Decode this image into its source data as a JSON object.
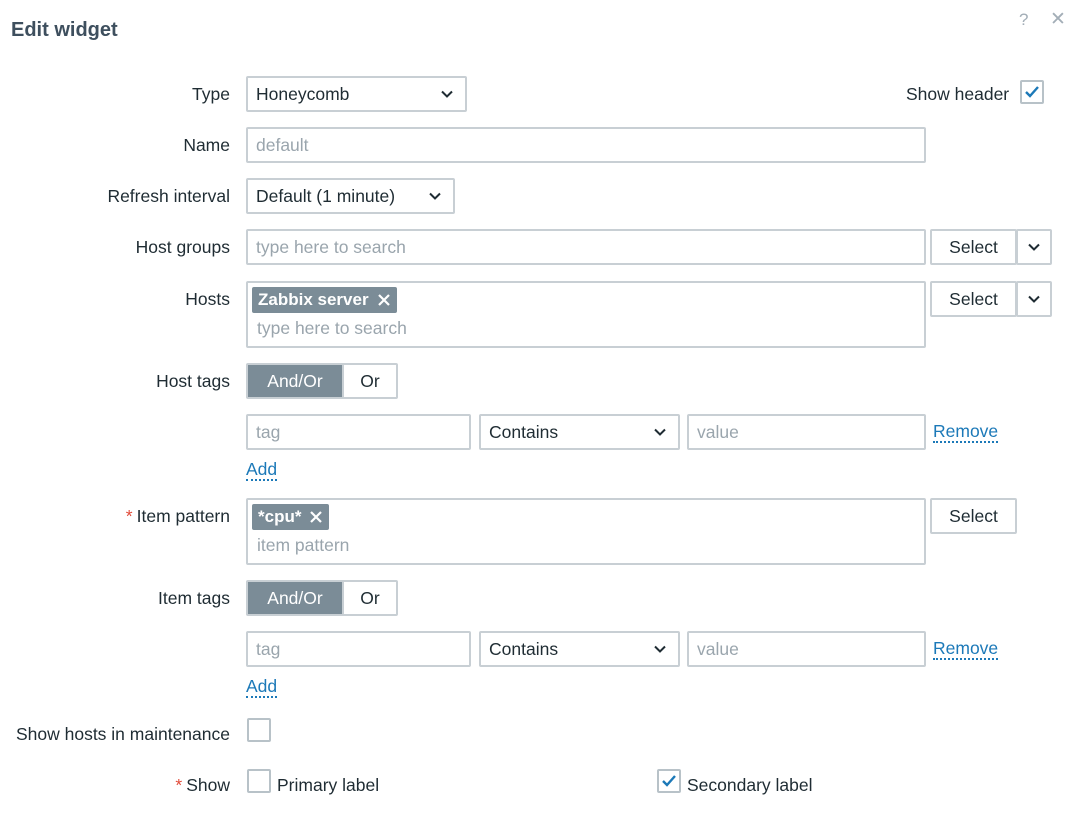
{
  "dialog": {
    "title": "Edit widget",
    "help_glyph": "?",
    "close_glyph": "✕"
  },
  "fields": {
    "type": {
      "label": "Type",
      "value": "Honeycomb"
    },
    "show_header": {
      "label": "Show header",
      "checked": true
    },
    "name": {
      "label": "Name",
      "placeholder": "default"
    },
    "refresh": {
      "label": "Refresh interval",
      "value": "Default (1 minute)"
    },
    "host_groups": {
      "label": "Host groups",
      "placeholder": "type here to search",
      "select_label": "Select"
    },
    "hosts": {
      "label": "Hosts",
      "chips": [
        "Zabbix server"
      ],
      "placeholder": "type here to search",
      "select_label": "Select"
    },
    "host_tags": {
      "label": "Host tags",
      "mode_options": [
        "And/Or",
        "Or"
      ],
      "selected_mode": "And/Or",
      "row": {
        "tag_placeholder": "tag",
        "operator": "Contains",
        "value_placeholder": "value",
        "remove_label": "Remove"
      },
      "add_label": "Add"
    },
    "item_pattern": {
      "label": "Item pattern",
      "required": "*",
      "chips": [
        "*cpu*"
      ],
      "placeholder": "item pattern",
      "select_label": "Select"
    },
    "item_tags": {
      "label": "Item tags",
      "mode_options": [
        "And/Or",
        "Or"
      ],
      "selected_mode": "And/Or",
      "row": {
        "tag_placeholder": "tag",
        "operator": "Contains",
        "value_placeholder": "value",
        "remove_label": "Remove"
      },
      "add_label": "Add"
    },
    "maintenance": {
      "label": "Show hosts in maintenance",
      "checked": false
    },
    "show": {
      "label": "Show",
      "required": "*",
      "primary": {
        "label": "Primary label",
        "checked": false
      },
      "secondary": {
        "label": "Secondary label",
        "checked": true
      }
    }
  },
  "colors": {
    "accent": "#1c79b8",
    "chip": "#7b8c97",
    "required": "#e14b3a",
    "border": "#c8cfd4"
  }
}
